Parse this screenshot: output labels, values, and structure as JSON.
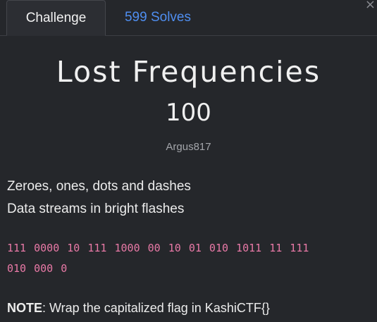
{
  "tabs": {
    "challenge_label": "Challenge",
    "solves_label": "599 Solves"
  },
  "close_symbol": "×",
  "challenge": {
    "name": "Lost Frequencies",
    "points": "100",
    "author": "Argus817",
    "description_lines": [
      "Zeroes, ones, dots and dashes",
      "Data streams in bright flashes"
    ],
    "code_line_1": "111 0000 10 111 1000 00 10 01 010 1011 11 111",
    "code_line_2": "010 000 0",
    "note_label": "NOTE",
    "note_text": ": Wrap the capitalized flag in KashiCTF{}"
  },
  "colors": {
    "background": "#25272b",
    "tab_link": "#4f8ef0",
    "code": "#e879a6"
  }
}
